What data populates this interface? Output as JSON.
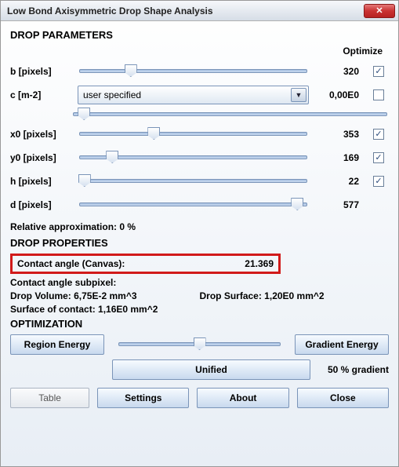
{
  "window_title": "Low Bond Axisymmetric Drop Shape Analysis",
  "sections": {
    "params_header": "DROP PARAMETERS",
    "properties_header": "DROP PROPERTIES",
    "optimization_header": "OPTIMIZATION"
  },
  "optimize_label": "Optimize",
  "params": {
    "b": {
      "label": "b [pixels]",
      "value": "320",
      "knob_pct": 23,
      "opt": true
    },
    "c": {
      "label": "c [m-2]",
      "value": "0,00E0",
      "dropdown": "user specified",
      "opt": false,
      "extra_knob_pct": 4
    },
    "x0": {
      "label": "x0 [pixels]",
      "value": "353",
      "knob_pct": 33,
      "opt": true
    },
    "y0": {
      "label": "y0 [pixels]",
      "value": "169",
      "knob_pct": 15,
      "opt": true
    },
    "h": {
      "label": "h [pixels]",
      "value": "22",
      "knob_pct": 3,
      "opt": true
    },
    "d": {
      "label": "d [pixels]",
      "value": "577",
      "knob_pct": 95,
      "opt": null
    }
  },
  "rel_approx": "Relative approximation: 0 %",
  "properties": {
    "contact_angle_label": "Contact angle (Canvas):",
    "contact_angle_value": "21.369",
    "subpixel": "Contact angle subpixel:",
    "drop_volume": "Drop Volume: 6,75E-2 mm^3",
    "drop_surface": "Drop Surface: 1,20E0 mm^2",
    "surface_contact": "Surface of contact: 1,16E0 mm^2"
  },
  "optimization": {
    "region_energy": "Region Energy",
    "gradient_energy": "Gradient Energy",
    "unified": "Unified",
    "gradient_pct": "50 % gradient",
    "slider_knob_pct": 50
  },
  "buttons": {
    "table": "Table",
    "settings": "Settings",
    "about": "About",
    "close": "Close"
  }
}
